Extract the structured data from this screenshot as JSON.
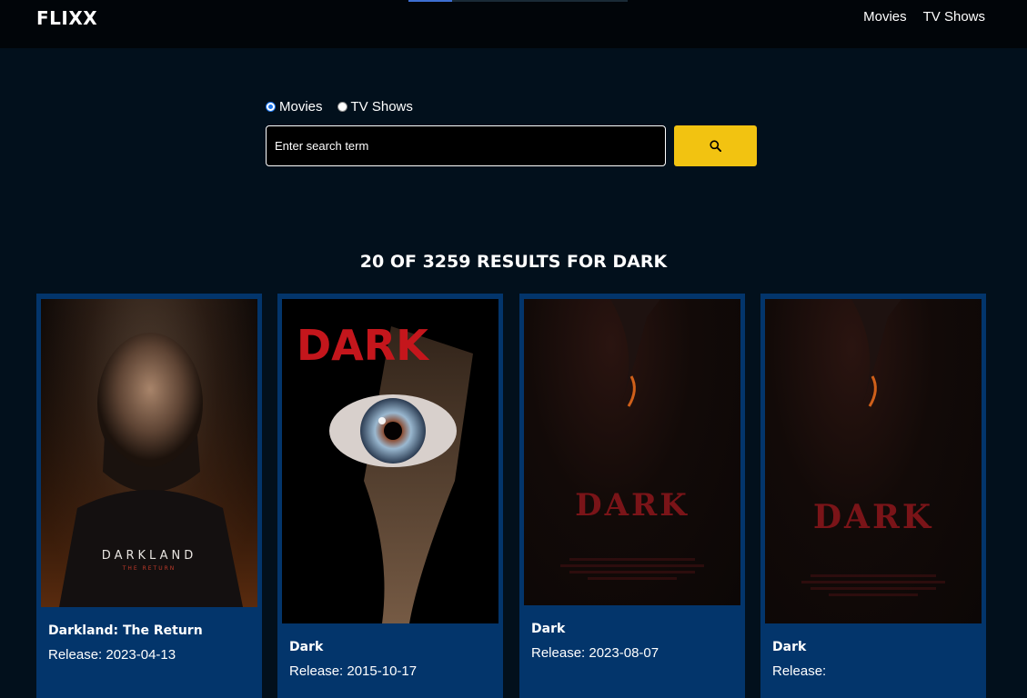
{
  "header": {
    "logo": "FLIXX",
    "nav": [
      "Movies",
      "TV Shows"
    ],
    "loading_progress": 0.2
  },
  "search": {
    "options": [
      {
        "label": "Movies",
        "checked": true
      },
      {
        "label": "TV Shows",
        "checked": false
      }
    ],
    "placeholder": "Enter search term",
    "value": "",
    "button_icon": "search-icon",
    "button_color": "#f2c311"
  },
  "results": {
    "heading": "20 OF 3259 RESULTS FOR DARK",
    "items": [
      {
        "title": "Darkland: The Return",
        "release_label": "Release:",
        "release_date": "2023-04-13",
        "poster_text": "DARKLAND",
        "poster_subtext": "THE RETURN"
      },
      {
        "title": "Dark",
        "release_label": "Release:",
        "release_date": "2015-10-17",
        "poster_text": "DARK"
      },
      {
        "title": "Dark",
        "release_label": "Release:",
        "release_date": "2023-08-07",
        "poster_text": "DARK"
      },
      {
        "title": "Dark",
        "release_label": "Release:",
        "release_date": "",
        "poster_text": "DARK"
      }
    ]
  },
  "colors": {
    "background": "#02101c",
    "header": "#010509",
    "card": "#03356b",
    "accent": "#f2c311"
  }
}
